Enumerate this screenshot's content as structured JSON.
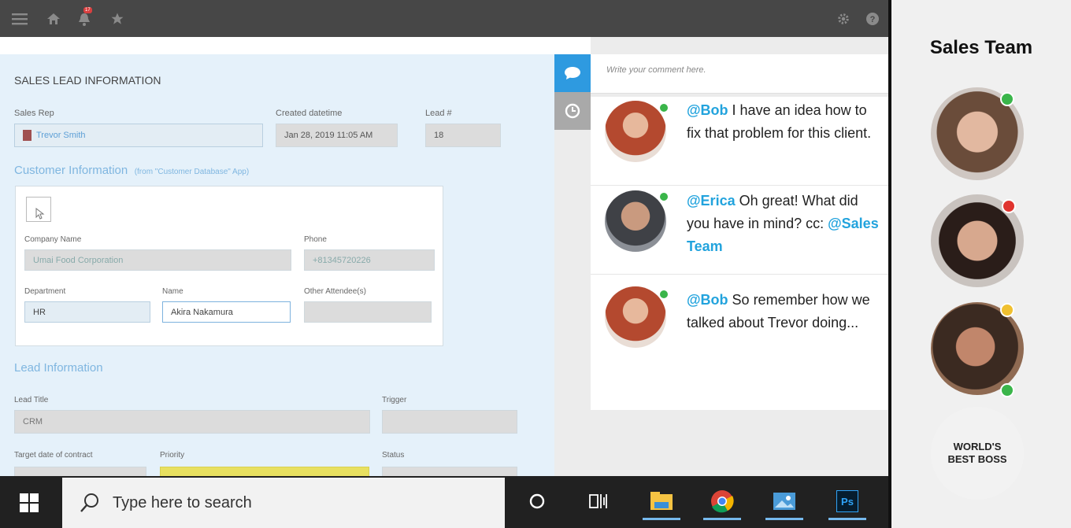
{
  "topbar": {
    "menu_icon": "hamburger-icon",
    "home_icon": "home-icon",
    "notif_icon": "bell-icon",
    "notif_count": "17",
    "fav_icon": "star-icon",
    "settings_icon": "gear-icon",
    "help_icon": "help-icon"
  },
  "form": {
    "title": "SALES LEAD INFORMATION",
    "sales_rep_label": "Sales Rep",
    "sales_rep_value": "Trevor Smith",
    "created_label": "Created datetime",
    "created_value": "Jan 28, 2019 11:05 AM",
    "lead_num_label": "Lead #",
    "lead_num_value": "18",
    "customer_section": "Customer Information",
    "customer_source": "(from \"Customer Database\" App)",
    "company_label": "Company Name",
    "company_value": "Umai Food Corporation",
    "phone_label": "Phone",
    "phone_value": "+81345720226",
    "department_label": "Department",
    "department_value": "HR",
    "name_label": "Name",
    "name_value": "Akira Nakamura",
    "attendees_label": "Other Attendee(s)",
    "attendees_value": "",
    "lead_section": "Lead Information",
    "lead_title_label": "Lead Title",
    "lead_title_value": "CRM",
    "trigger_label": "Trigger",
    "target_date_label": "Target date of contract",
    "priority_label": "Priority",
    "status_label": "Status"
  },
  "comments": {
    "placeholder": "Write your comment here.",
    "items": [
      {
        "mention": "@Bob",
        "text": " I have an idea how to fix that problem for this client.",
        "mention2": "",
        "status": "online"
      },
      {
        "mention": "@Erica",
        "text": " Oh great! What did you have in mind? cc: ",
        "mention2": "@Sales Team",
        "status": "online"
      },
      {
        "mention": "@Bob",
        "text": " So remember how we talked about Trevor doing...",
        "mention2": "",
        "status": "online"
      }
    ]
  },
  "taskbar": {
    "start_icon": "windows-icon",
    "search_placeholder": "Type here to search",
    "search_icon": "search-icon",
    "cortana_icon": "circle-icon",
    "taskview_icon": "task-view-icon",
    "apps": [
      "file-explorer-icon",
      "chrome-icon",
      "photos-icon",
      "photoshop-icon"
    ],
    "photoshop_label": "Ps"
  },
  "team": {
    "title": "Sales Team",
    "members": [
      {
        "status": "online",
        "status_color": "#3ab54a"
      },
      {
        "status": "busy",
        "status_color": "#e0342f"
      },
      {
        "status": "away",
        "status_color": "#f0c030"
      },
      {
        "status": "online",
        "status_color": "#3ab54a"
      }
    ],
    "mug_text": "WORLD'S BEST BOSS"
  },
  "colors": {
    "accent": "#22a3dd",
    "online": "#3ab54a",
    "busy": "#e0342f",
    "away": "#f0c030"
  }
}
